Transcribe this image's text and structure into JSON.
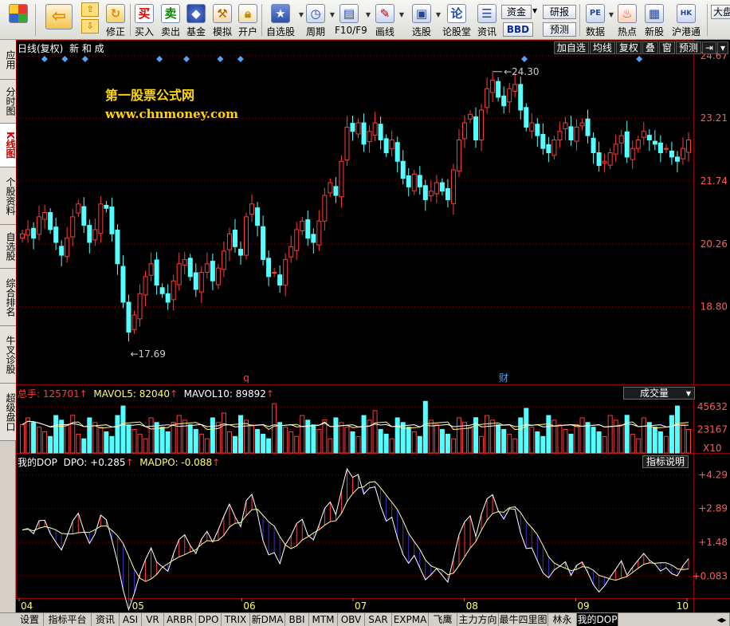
{
  "toolbar": {
    "buttons": [
      {
        "label": "",
        "icon": "grid-logo-icon"
      },
      {
        "label": "",
        "icon": "back-arrow-icon"
      },
      {
        "label": "修正",
        "icon": "refresh-icon"
      },
      {
        "label": "买入",
        "icon": "buy-icon",
        "glyph": "买"
      },
      {
        "label": "卖出",
        "icon": "sell-icon",
        "glyph": "卖"
      },
      {
        "label": "基金",
        "icon": "fund-icon"
      },
      {
        "label": "模拟",
        "icon": "hammer-icon"
      },
      {
        "label": "开户",
        "icon": "lock-icon"
      },
      {
        "label": "自选股",
        "icon": "star-icon"
      },
      {
        "label": "周期",
        "icon": "clock-icon"
      },
      {
        "label": "F10/F9",
        "icon": "f10-icon"
      },
      {
        "label": "画线",
        "icon": "pen-icon"
      },
      {
        "label": "选股",
        "icon": "screen-icon"
      },
      {
        "label": "论股堂",
        "icon": "forum-icon",
        "glyph": "论"
      },
      {
        "label": "资讯",
        "icon": "news-icon"
      },
      {
        "label": "数据",
        "icon": "pe-icon",
        "glyph": "PE"
      },
      {
        "label": "热点",
        "icon": "hot-icon"
      },
      {
        "label": "新股",
        "icon": "newstock-icon"
      },
      {
        "label": "沪港通",
        "icon": "hk-icon"
      }
    ],
    "mini_buttons": [
      "资金",
      "研报",
      "BBD",
      "预测",
      "大盘"
    ]
  },
  "side_tabs": [
    {
      "label": "应用",
      "active": false
    },
    {
      "label": "分时图",
      "active": false
    },
    {
      "label": "K线图",
      "active": true
    },
    {
      "label": "个股资料",
      "active": false
    },
    {
      "label": "自选股",
      "active": false
    },
    {
      "label": "综合排名",
      "active": false
    },
    {
      "label": "牛叉诊股",
      "active": false
    },
    {
      "label": "超级盘口",
      "active": false
    }
  ],
  "chart_header": {
    "mode": "日线(复权)",
    "stock": "新 和 成"
  },
  "header_buttons": [
    "加自选",
    "均线",
    "复权",
    "叠",
    "窗",
    "预测"
  ],
  "watermark": {
    "line1": "第一股票公式网",
    "line2": "www.chnmoney.com"
  },
  "annotations": {
    "high": "24.30",
    "low": "17.69",
    "marker_q": "q",
    "marker_cai": "财"
  },
  "volume_panel": {
    "label_total": "总手: 125701",
    "label_ma5": "MAVOL5: 82040",
    "label_ma10": "MAVOL10: 89892",
    "dropdown": "成交量",
    "scale_note": "X10"
  },
  "indicator_panel": {
    "label_name": "我的DOP",
    "label_dpo": "DPO: +0.285",
    "label_madpo": "MADPO: -0.088",
    "help_button": "指标说明"
  },
  "bottom_tabs": [
    "设置",
    "指标平台",
    "资讯",
    "ASI",
    "VR",
    "ARBR",
    "DPO",
    "TRIX",
    "新DMA",
    "BBI",
    "MTM",
    "OBV",
    "SAR",
    "EXPMA",
    "飞鹰",
    "主力方向",
    "最牛四里图",
    "林永",
    "我的DOP"
  ],
  "colors": {
    "up": "#ff3b3b",
    "down": "#54ffff",
    "bg": "#000000",
    "grid": "#8b0000",
    "axis_text": "#ff5a5a",
    "ma": "#ffffff"
  },
  "chart_data": [
    {
      "type": "candlestick",
      "title": "新 和 成",
      "price_axis_ticks": [
        24.67,
        23.21,
        21.74,
        20.26,
        18.8
      ],
      "x_tick_labels": [
        "04",
        "05",
        "06",
        "07",
        "08",
        "09",
        "10"
      ],
      "high": 24.3,
      "low": 17.69,
      "close_series": [
        20.5,
        20.6,
        20.4,
        20.9,
        21.0,
        20.6,
        20.3,
        20.0,
        20.4,
        20.9,
        21.2,
        20.7,
        20.3,
        20.6,
        21.2,
        21.1,
        20.5,
        19.8,
        18.9,
        18.2,
        18.6,
        19.1,
        19.5,
        19.8,
        19.3,
        19.1,
        18.9,
        19.4,
        19.8,
        19.9,
        19.5,
        19.2,
        19.6,
        19.8,
        19.4,
        19.7,
        20.1,
        20.5,
        20.2,
        20.0,
        20.9,
        21.2,
        20.7,
        19.9,
        19.5,
        19.6,
        19.3,
        19.9,
        20.2,
        20.6,
        20.8,
        20.4,
        20.3,
        20.8,
        21.4,
        21.7,
        21.4,
        22.2,
        23.0,
        22.9,
        23.1,
        22.6,
        22.9,
        23.1,
        22.7,
        22.4,
        22.7,
        22.2,
        21.8,
        21.6,
        21.9,
        21.6,
        21.3,
        21.5,
        21.7,
        21.5,
        21.3,
        22.0,
        22.7,
        23.1,
        23.3,
        22.7,
        23.4,
        23.9,
        24.1,
        23.7,
        23.5,
        23.9,
        24.0,
        23.4,
        23.0,
        23.1,
        22.8,
        22.5,
        22.4,
        22.7,
        22.9,
        23.1,
        22.7,
        23.0,
        23.1,
        22.8,
        22.4,
        22.1,
        22.2,
        22.4,
        22.6,
        22.8,
        22.3,
        22.5,
        22.7,
        22.9,
        22.7,
        22.6,
        22.4,
        22.5,
        22.3,
        22.2,
        22.5,
        22.7
      ]
    },
    {
      "type": "bar",
      "title": "成交量",
      "y_axis_ticks": [
        45632,
        23167
      ],
      "series": [
        {
          "name": "总手",
          "last": 125701
        },
        {
          "name": "MAVOL5",
          "last": 82040
        },
        {
          "name": "MAVOL10",
          "last": 89892
        }
      ]
    },
    {
      "type": "line",
      "title": "我的DOP",
      "y_axis_ticks": [
        4.29,
        2.89,
        1.48,
        0.083
      ],
      "series": [
        {
          "name": "DPO",
          "last": 0.285
        },
        {
          "name": "MADPO",
          "last": -0.088
        }
      ]
    }
  ]
}
